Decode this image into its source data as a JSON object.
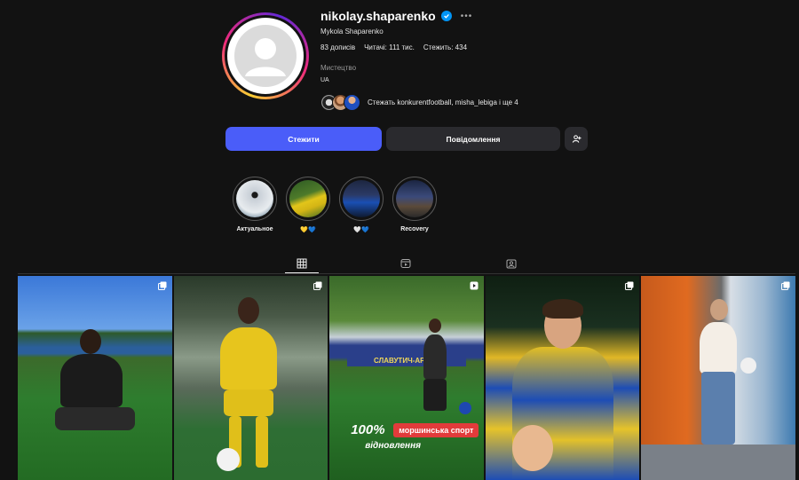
{
  "profile": {
    "username": "nikolay.shaparenko",
    "full_name": "Mykola Shaparenko",
    "posts_label": "83 дописів",
    "followers_label": "Читачі: 111 тис.",
    "following_label": "Стежить: 434",
    "category": "Мистецтво",
    "bio": "UA",
    "followed_by_text": "Стежать konkurentfootball, misha_lebiga і ще 4",
    "more_icon": "more-horizontal-icon",
    "verified_icon": "verified-badge-icon"
  },
  "actions": {
    "follow_label": "Стежити",
    "message_label": "Повідомлення",
    "add_icon": "add-user-icon"
  },
  "highlights": [
    {
      "label": "Актуальное"
    },
    {
      "label": "💛💙"
    },
    {
      "label": "🤍💙"
    },
    {
      "label": "Recovery"
    }
  ],
  "tabs": [
    {
      "name": "posts",
      "icon": "grid-icon",
      "active": true
    },
    {
      "name": "reels",
      "icon": "reels-icon",
      "active": false
    },
    {
      "name": "tagged",
      "icon": "tagged-icon",
      "active": false
    }
  ],
  "posts": [
    {
      "badge": "multi-image-icon"
    },
    {
      "badge": "multi-image-icon"
    },
    {
      "badge": "reel-icon",
      "overlay_main": "100%",
      "overlay_logo": "моршинська спорт",
      "overlay_sub": "відновлення",
      "banner": "СЛАВУТИЧ-АРЕНА"
    },
    {
      "badge": "multi-image-icon"
    },
    {
      "badge": "multi-image-icon"
    }
  ],
  "colors": {
    "background": "#121212",
    "follow_button": "#4a5df9",
    "secondary_button": "#2a2a2e",
    "verified": "#0095f6"
  }
}
